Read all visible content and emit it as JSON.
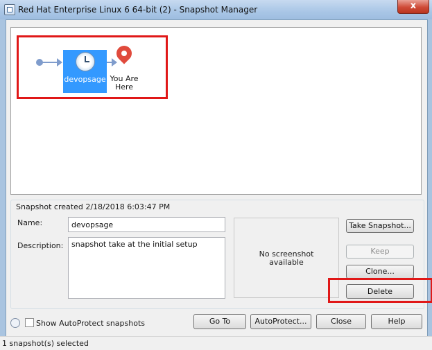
{
  "window": {
    "title": "Red Hat Enterprise Linux 6 64-bit (2) - Snapshot Manager",
    "close_glyph": "x"
  },
  "tree": {
    "snapshot_name": "devopsage",
    "you_are_here": "You Are Here",
    "icons": [
      "start-dot-icon",
      "clock-icon",
      "location-pin-icon"
    ]
  },
  "details": {
    "created": "Snapshot created 2/18/2018 6:03:47 PM",
    "name_label": "Name:",
    "name_value": "devopsage",
    "description_label": "Description:",
    "description_value": "snapshot take at the initial setup",
    "preview_text": "No screenshot\navailable"
  },
  "buttons": {
    "take_snapshot": "Take Snapshot...",
    "keep": "Keep",
    "clone": "Clone...",
    "delete": "Delete",
    "go_to": "Go To",
    "autoprotect": "AutoProtect...",
    "close": "Close",
    "help": "Help"
  },
  "footer": {
    "show_autoprotect": "Show AutoProtect snapshots",
    "status": "1 snapshot(s) selected"
  },
  "colors": {
    "selection": "#3399ff",
    "highlight_box": "#e01818",
    "pin": "#e04a3c"
  }
}
